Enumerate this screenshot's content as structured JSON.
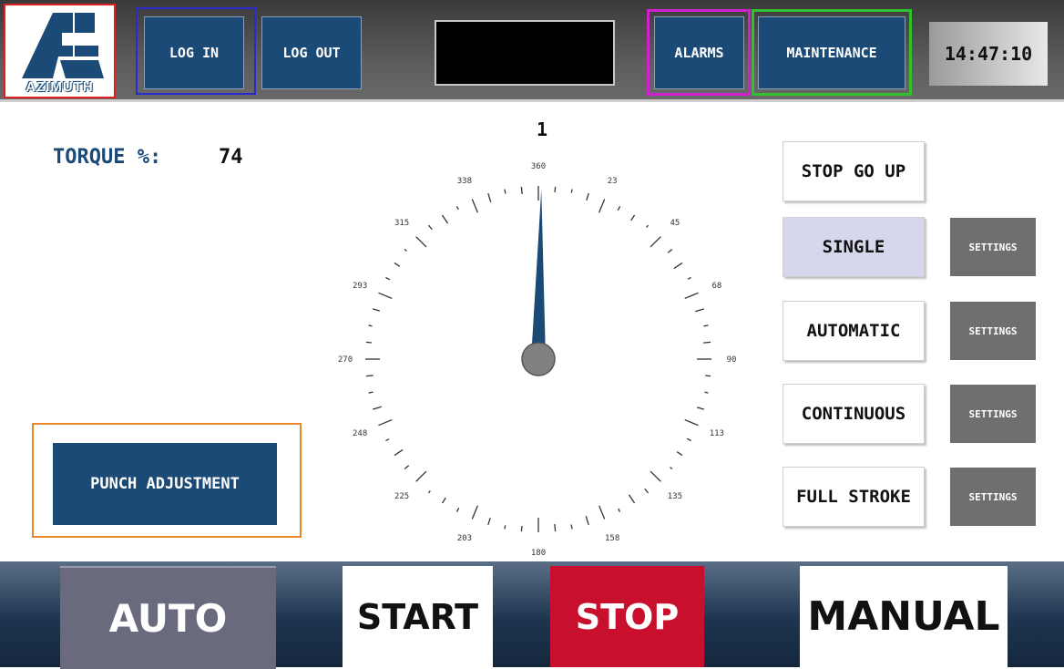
{
  "header": {
    "logo_text": "AZIMUTH",
    "login_label": "LOG IN",
    "logout_label": "LOG OUT",
    "alarms_label": "ALARMS",
    "maintenance_label": "MAINTENANCE",
    "clock": "14:47:10"
  },
  "colors": {
    "navy": "#1b4a76",
    "stop_red": "#c8102e",
    "settings_gray": "#6f6f6f",
    "auto_gray": "#6a6a7e",
    "active_mode": "#d6d6ec"
  },
  "torque": {
    "label": "TORQUE %:",
    "value": "74"
  },
  "punch_adjustment_label": "PUNCH ADJUSTMENT",
  "gauge": {
    "top_value": "1",
    "labels": [
      "360",
      "23",
      "45",
      "68",
      "90",
      "113",
      "135",
      "158",
      "180",
      "203",
      "225",
      "248",
      "270",
      "293",
      "315",
      "338"
    ],
    "needle_angle_deg": 1
  },
  "modes": {
    "stop_go_up": "STOP GO UP",
    "single": "SINGLE",
    "automatic": "AUTOMATIC",
    "continuous": "CONTINUOUS",
    "full_stroke": "FULL STROKE",
    "settings_label": "SETTINGS",
    "active": "single"
  },
  "footer": {
    "auto": "AUTO",
    "start": "START",
    "stop": "STOP",
    "manual": "MANUAL"
  }
}
